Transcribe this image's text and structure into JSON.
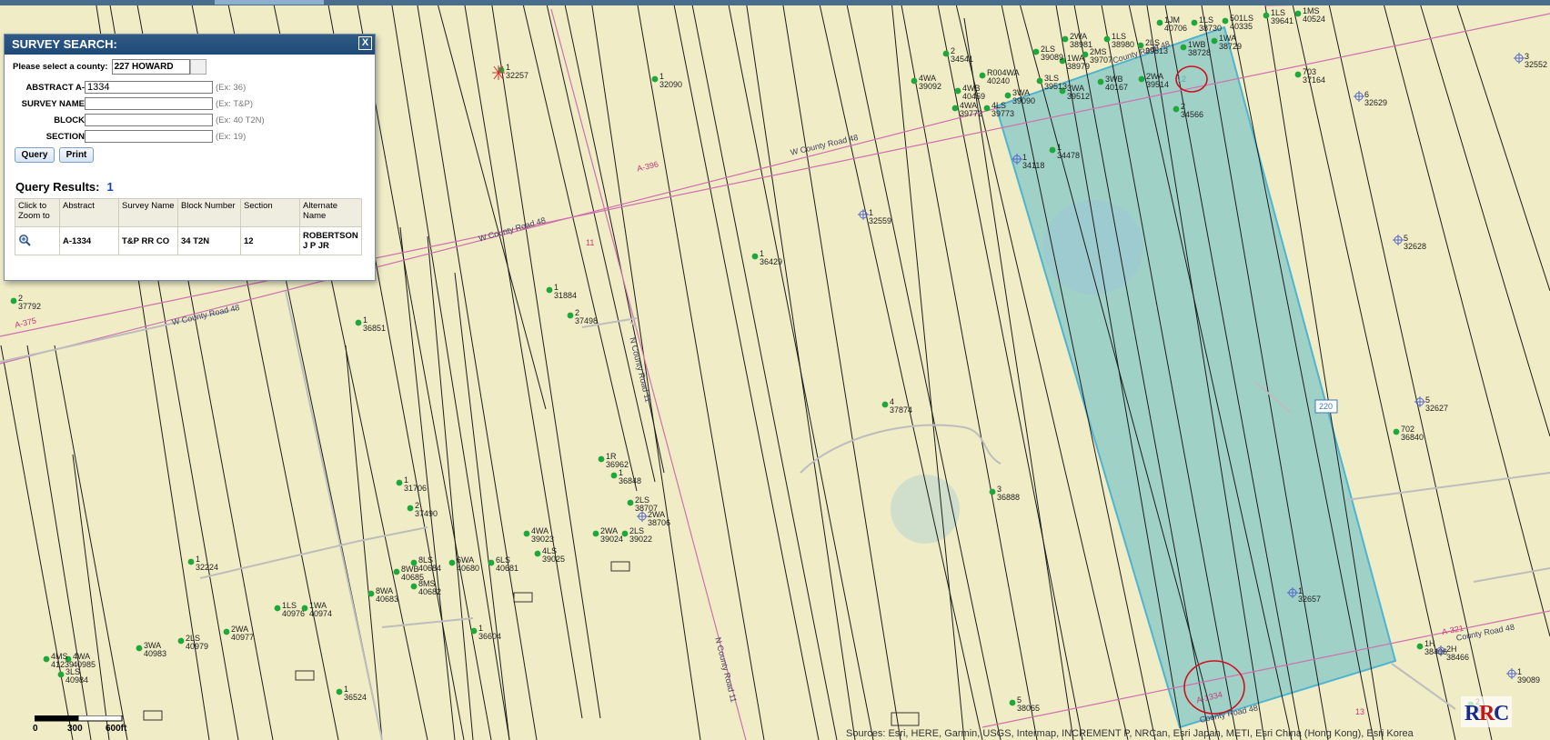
{
  "panel": {
    "title": "SURVEY SEARCH:",
    "close_label": "X",
    "county_label": "Please select a county:",
    "county_value": "227 HOWARD",
    "abstract_label": "ABSTRACT A-",
    "abstract_value": "1334",
    "abstract_example": "(Ex: 36)",
    "survey_label": "SURVEY NAME",
    "survey_example": "(Ex: T&P)",
    "block_label": "BLOCK",
    "block_example": "(Ex: 40 T2N)",
    "section_label": "SECTION",
    "section_example": "(Ex: 19)",
    "query_button": "Query",
    "print_button": "Print",
    "results_title": "Query Results:",
    "results_count": "1",
    "columns": [
      "Click to Zoom to",
      "Abstract",
      "Survey Name",
      "Block Number",
      "Section",
      "Alternate Name"
    ],
    "row": {
      "abstract": "A-1334",
      "survey": "T&P RR CO",
      "block": "34 T2N",
      "section": "12",
      "alternate": "ROBERTSON J P JR"
    }
  },
  "roads": {
    "r1": "W County Road 48",
    "r2": "W County Road 48",
    "r3": "W County Road 48",
    "r4": "N County Road 11",
    "r5": "N County Road 11",
    "r6": "County Road 48",
    "r7": "County Road 48",
    "r8": "County Road 48",
    "shield": "220"
  },
  "abstracts": {
    "a396": "A-396",
    "a375": "A-375",
    "a321": "A-321",
    "a1334": "A-1334",
    "sec12": "12",
    "sec11": "11",
    "sec13": "13"
  },
  "wells": [
    {
      "id": "w1",
      "l1": "1",
      "l2": "32257"
    },
    {
      "id": "w2",
      "l1": "1",
      "l2": "32090"
    },
    {
      "id": "w3",
      "l1": "2",
      "l2": "34541"
    },
    {
      "id": "w4",
      "l1": "4WA",
      "l2": "39092"
    },
    {
      "id": "w5",
      "l1": "R004WA",
      "l2": "40240"
    },
    {
      "id": "w6",
      "l1": "4WB",
      "l2": "40459"
    },
    {
      "id": "w7",
      "l1": "4WA",
      "l2": "39772"
    },
    {
      "id": "w8",
      "l1": "4LS",
      "l2": "39773"
    },
    {
      "id": "w9",
      "l1": "3WA",
      "l2": "39090"
    },
    {
      "id": "w10",
      "l1": "2LS",
      "l2": "39089"
    },
    {
      "id": "w11",
      "l1": "3LS",
      "l2": "39513"
    },
    {
      "id": "w12",
      "l1": "1WA",
      "l2": "38979"
    },
    {
      "id": "w13",
      "l1": "2WA",
      "l2": "38981"
    },
    {
      "id": "w14",
      "l1": "2MS",
      "l2": "39707"
    },
    {
      "id": "w15",
      "l1": "1LS",
      "l2": "38980"
    },
    {
      "id": "w16",
      "l1": "3WA",
      "l2": "39512"
    },
    {
      "id": "w17",
      "l1": "3WB",
      "l2": "40167"
    },
    {
      "id": "w18",
      "l1": "2LS",
      "l2": "39513"
    },
    {
      "id": "w19",
      "l1": "1JM",
      "l2": "40706"
    },
    {
      "id": "w20",
      "l1": "1LS",
      "l2": "38730"
    },
    {
      "id": "w21",
      "l1": "1WB",
      "l2": "38728"
    },
    {
      "id": "w22",
      "l1": "1WA",
      "l2": "38729"
    },
    {
      "id": "w23",
      "l1": "2WA",
      "l2": "39514"
    },
    {
      "id": "w24",
      "l1": "501LS",
      "l2": "40335"
    },
    {
      "id": "w25",
      "l1": "1LS",
      "l2": "39641"
    },
    {
      "id": "w26",
      "l1": "1MS",
      "l2": "40524"
    },
    {
      "id": "w27",
      "l1": "703",
      "l2": "37164"
    },
    {
      "id": "w28",
      "l1": "2",
      "l2": "34566"
    },
    {
      "id": "w29",
      "l1": "1",
      "l2": "34478"
    },
    {
      "id": "w30",
      "l1": "1",
      "l2": "34118"
    },
    {
      "id": "w31",
      "l1": "6",
      "l2": "32629"
    },
    {
      "id": "w32",
      "l1": "3",
      "l2": "32552"
    },
    {
      "id": "w33",
      "l1": "1",
      "l2": "32559"
    },
    {
      "id": "w34",
      "l1": "1",
      "l2": "36429"
    },
    {
      "id": "w35",
      "l1": "5",
      "l2": "32628"
    },
    {
      "id": "w36",
      "l1": "1",
      "l2": "31884"
    },
    {
      "id": "w37",
      "l1": "2",
      "l2": "37498"
    },
    {
      "id": "w38",
      "l1": "1",
      "l2": "36851"
    },
    {
      "id": "w39",
      "l1": "2",
      "l2": "37792"
    },
    {
      "id": "w40",
      "l1": "4",
      "l2": "37874"
    },
    {
      "id": "w41",
      "l1": "5",
      "l2": "32627"
    },
    {
      "id": "w42",
      "l1": "702",
      "l2": "36840"
    },
    {
      "id": "w43",
      "l1": "1R",
      "l2": "36962"
    },
    {
      "id": "w44",
      "l1": "1",
      "l2": "36848"
    },
    {
      "id": "w45",
      "l1": "2LS",
      "l2": "38707"
    },
    {
      "id": "w46",
      "l1": "2WA",
      "l2": "38706"
    },
    {
      "id": "w47",
      "l1": "1",
      "l2": "31706"
    },
    {
      "id": "w48",
      "l1": "2",
      "l2": "37490"
    },
    {
      "id": "w49",
      "l1": "3",
      "l2": "36888"
    },
    {
      "id": "w50",
      "l1": "4WA",
      "l2": "39023"
    },
    {
      "id": "w51",
      "l1": "2WA",
      "l2": "39024"
    },
    {
      "id": "w52",
      "l1": "2LS",
      "l2": "39022"
    },
    {
      "id": "w53",
      "l1": "4LS",
      "l2": "39025"
    },
    {
      "id": "w54",
      "l1": "1",
      "l2": "32224"
    },
    {
      "id": "w55",
      "l1": "8WB",
      "l2": "40685"
    },
    {
      "id": "w56",
      "l1": "8LS",
      "l2": "40684"
    },
    {
      "id": "w57",
      "l1": "6WA",
      "l2": "40680"
    },
    {
      "id": "w58",
      "l1": "6LS",
      "l2": "40681"
    },
    {
      "id": "w59",
      "l1": "8MS",
      "l2": "40682"
    },
    {
      "id": "w60",
      "l1": "8WA",
      "l2": "40683"
    },
    {
      "id": "w61",
      "l1": "1LS",
      "l2": "40976"
    },
    {
      "id": "w62",
      "l1": "1WA",
      "l2": "40974"
    },
    {
      "id": "w63",
      "l1": "1",
      "l2": "32657"
    },
    {
      "id": "w64",
      "l1": "2WA",
      "l2": "40977"
    },
    {
      "id": "w65",
      "l1": "2LS",
      "l2": "40979"
    },
    {
      "id": "w66",
      "l1": "3WA",
      "l2": "40983"
    },
    {
      "id": "w67",
      "l1": "1",
      "l2": "36604"
    },
    {
      "id": "w68",
      "l1": "4MS",
      "l2": "41239"
    },
    {
      "id": "w69",
      "l1": "4WA",
      "l2": "40985"
    },
    {
      "id": "w70",
      "l1": "3LS",
      "l2": "40984"
    },
    {
      "id": "w71",
      "l1": "1",
      "l2": "36524"
    },
    {
      "id": "w72",
      "l1": "5",
      "l2": "38065"
    },
    {
      "id": "w73",
      "l1": "1H",
      "l2": "38406"
    },
    {
      "id": "w74",
      "l1": "2H",
      "l2": "38466"
    },
    {
      "id": "w75",
      "l1": "1",
      "l2": "39089"
    },
    {
      "id": "w76",
      "l1": "2",
      "l2": "36"
    }
  ],
  "scale": {
    "zero": "0",
    "mid": "300",
    "end": "600ft"
  },
  "sources": "Sources: Esri, HERE, Garmin, USGS, Intermap, INCREMENT P, NRCan, Esri Japan, METI, Esri China (Hong Kong), Esri Korea"
}
